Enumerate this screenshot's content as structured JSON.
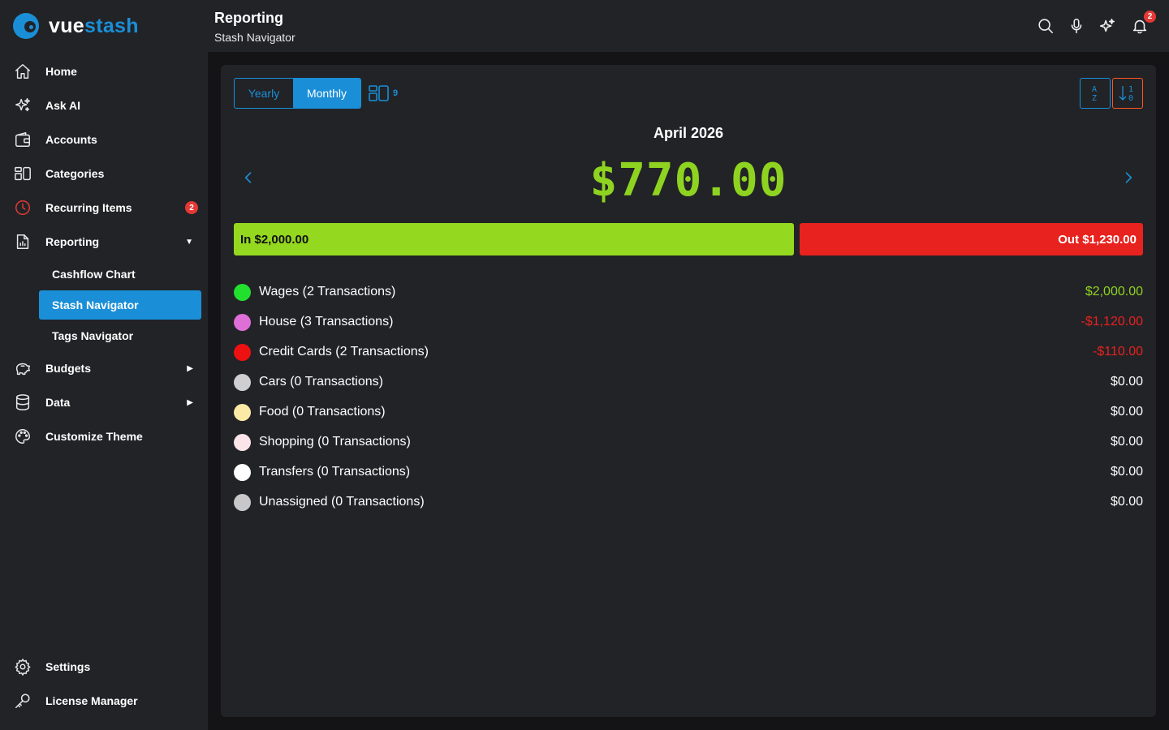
{
  "brand": {
    "part1": "vue",
    "part2": "stash"
  },
  "header": {
    "title": "Reporting",
    "subtitle": "Stash Navigator",
    "notification_count": "2"
  },
  "sidebar": {
    "items": [
      {
        "label": "Home",
        "icon": "home-icon"
      },
      {
        "label": "Ask AI",
        "icon": "sparkles-icon"
      },
      {
        "label": "Accounts",
        "icon": "wallet-icon"
      },
      {
        "label": "Categories",
        "icon": "categories-icon"
      },
      {
        "label": "Recurring Items",
        "icon": "clock-icon",
        "badge": "2"
      },
      {
        "label": "Reporting",
        "icon": "report-icon",
        "expanded": true
      },
      {
        "label": "Budgets",
        "icon": "piggy-bank-icon"
      },
      {
        "label": "Data",
        "icon": "database-icon"
      },
      {
        "label": "Customize Theme",
        "icon": "palette-icon"
      }
    ],
    "reporting_sub": [
      {
        "label": "Cashflow Chart"
      },
      {
        "label": "Stash Navigator",
        "active": true
      },
      {
        "label": "Tags Navigator"
      }
    ],
    "bottom": [
      {
        "label": "Settings",
        "icon": "gear-icon"
      },
      {
        "label": "License Manager",
        "icon": "key-icon"
      }
    ]
  },
  "controls": {
    "yearly_label": "Yearly",
    "monthly_label": "Monthly",
    "selected": "Monthly",
    "category_count": "9"
  },
  "summary": {
    "period": "April 2026",
    "net": "$770.00",
    "in_label": "In $2,000.00",
    "out_label": "Out $1,230.00",
    "in_share": 0.62
  },
  "categories": [
    {
      "label": "Wages (2 Transactions)",
      "amount": "$2,000.00",
      "dot": "#22e02e",
      "amount_color": "#8fd321"
    },
    {
      "label": "House (3 Transactions)",
      "amount": "-$1,120.00",
      "dot": "#de6fd6",
      "amount_color": "#e8221e"
    },
    {
      "label": "Credit Cards (2 Transactions)",
      "amount": "-$110.00",
      "dot": "#ee1111",
      "amount_color": "#e8221e"
    },
    {
      "label": "Cars (0 Transactions)",
      "amount": "$0.00",
      "dot": "#cfcfd1",
      "amount_color": "#ffffff"
    },
    {
      "label": "Food (0 Transactions)",
      "amount": "$0.00",
      "dot": "#fbeaa6",
      "amount_color": "#ffffff"
    },
    {
      "label": "Shopping (0 Transactions)",
      "amount": "$0.00",
      "dot": "#fbe4ea",
      "amount_color": "#ffffff"
    },
    {
      "label": "Transfers (0 Transactions)",
      "amount": "$0.00",
      "dot": "#ffffff",
      "amount_color": "#ffffff"
    },
    {
      "label": "Unassigned (0 Transactions)",
      "amount": "$0.00",
      "dot": "#c8c8ca",
      "amount_color": "#ffffff"
    }
  ],
  "colors": {
    "accent": "#1a8fd8",
    "positive": "#8fd321",
    "negative": "#e8221e"
  }
}
